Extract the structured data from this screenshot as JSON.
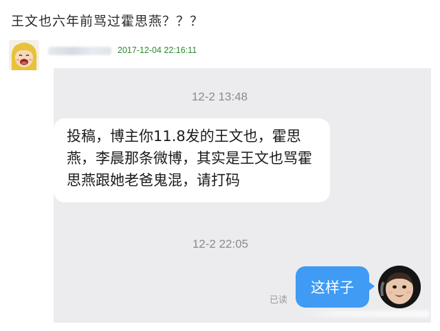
{
  "post": {
    "title": "王文也六年前骂过霍思燕？？？",
    "timestamp": "2017-12-04 22:16:11"
  },
  "chat": {
    "messages": [
      {
        "time": "12-2 13:48",
        "direction": "incoming",
        "text": "投稿，博主你11.8发的王文也，霍思燕，李晨那条微博，其实是王文也骂霍思燕跟她老爸鬼混，请打码"
      },
      {
        "time": "12-2 22:05",
        "direction": "outgoing",
        "text": "这样子",
        "status": "已读"
      }
    ]
  },
  "colors": {
    "timestamp_green": "#2c8a2c",
    "outgoing_bubble": "#3f9bf4",
    "chat_background": "#ececee"
  },
  "icons": {
    "poster_avatar": "cartoon-face-avatar-icon",
    "my_avatar": "baby-photo-avatar-icon"
  }
}
